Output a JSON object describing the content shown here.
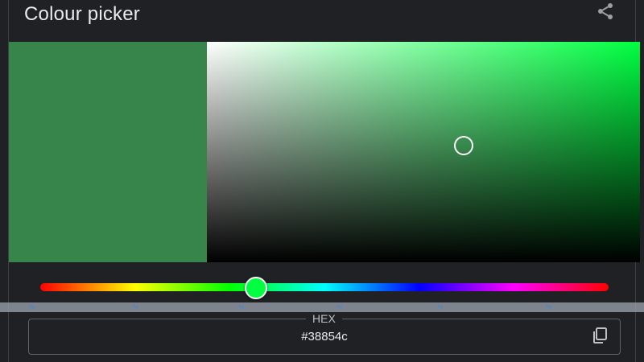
{
  "header": {
    "title": "Colour picker",
    "share_icon": "share-icon"
  },
  "color": {
    "selected_hex": "#38854c",
    "hue_hex": "#00ff41",
    "hue_degrees": 135,
    "saturation": 0.58,
    "value": 0.52
  },
  "hex_field": {
    "label": "HEX",
    "value": "#38854c",
    "copy_icon": "copy-icon"
  }
}
